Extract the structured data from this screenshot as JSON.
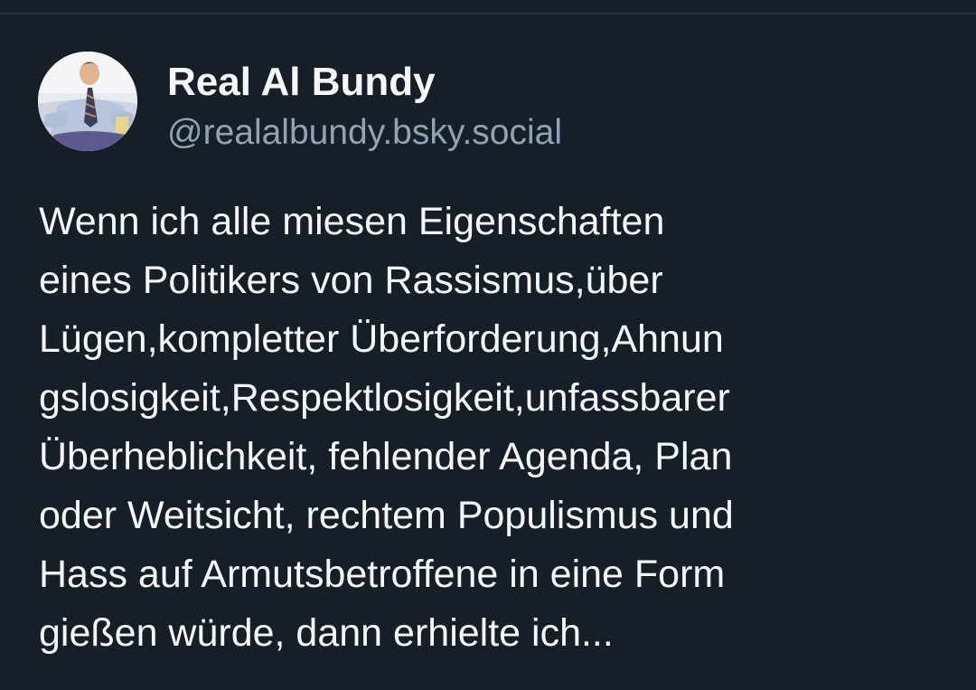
{
  "author": {
    "display_name": "Real Al Bundy",
    "handle": "@realalbundy.bsky.social"
  },
  "post": {
    "text_lines": [
      "Wenn ich alle miesen Eigenschaften",
      "eines Politikers von Rassismus,über",
      "Lügen,kompletter Überforderung,Ahnun",
      "gslosigkeit,Respektlosigkeit,unfassbarer",
      "Überheblichkeit, fehlender Agenda, Plan",
      "oder Weitsicht, rechtem Populismus und",
      "Hass auf Armutsbetroffene in eine Form",
      "gießen würde, dann erhielte ich..."
    ]
  },
  "colors": {
    "background": "#161e27",
    "text_primary": "#f4f6f8",
    "text_secondary": "#93a2b3"
  }
}
